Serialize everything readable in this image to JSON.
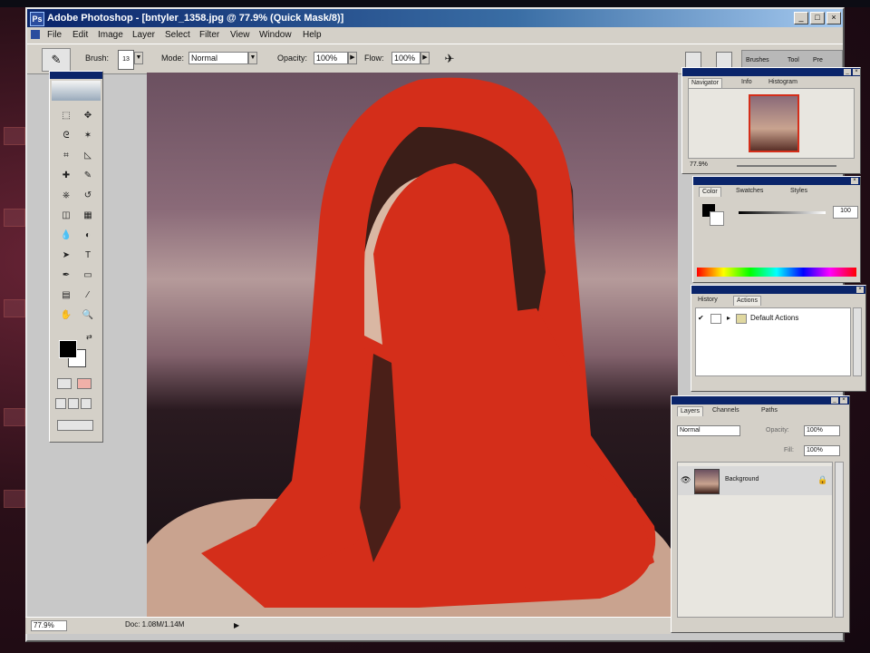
{
  "window": {
    "title": "Adobe Photoshop - [bntyler_1358.jpg @ 77.9% (Quick Mask/8)]",
    "app_icon": "Ps",
    "buttons": [
      "_",
      "□",
      "×"
    ]
  },
  "menu": [
    "File",
    "Edit",
    "Image",
    "Layer",
    "Select",
    "Filter",
    "View",
    "Window",
    "Help"
  ],
  "options_bar": {
    "brush_label": "Brush:",
    "brush_size": "13",
    "mode_label": "Mode:",
    "mode_value": "Normal",
    "opacity_label": "Opacity:",
    "opacity_value": "100%",
    "flow_label": "Flow:",
    "flow_value": "100%",
    "palette_well_tabs": [
      "Brushes",
      "Tool",
      "Pre"
    ]
  },
  "toolbox": {
    "tools": [
      "marquee-icon",
      "move-icon",
      "lasso-icon",
      "magic-wand-icon",
      "crop-icon",
      "slice-icon",
      "healing-icon",
      "brush-icon",
      "stamp-icon",
      "history-brush-icon",
      "eraser-icon",
      "gradient-icon",
      "blur-icon",
      "dodge-icon",
      "path-select-icon",
      "type-icon",
      "pen-icon",
      "shape-icon",
      "notes-icon",
      "eyedropper-icon",
      "hand-icon",
      "zoom-icon"
    ],
    "glyphs": [
      "⬚",
      "✥",
      "ᘓ",
      "✶",
      "⌗",
      "◺",
      "✚",
      "✎",
      "⎈",
      "↺",
      "◫",
      "▦",
      "💧",
      "◐",
      "➤",
      "T",
      "✒",
      "▭",
      "▤",
      "⁄",
      "✋",
      "🔍"
    ]
  },
  "status": {
    "zoom": "77.9%",
    "doc_size": "Doc: 1.08M/1.14M"
  },
  "navigator": {
    "tabs": [
      "Navigator",
      "Info",
      "Histogram"
    ],
    "zoom": "77.9%"
  },
  "color": {
    "tabs": [
      "Color",
      "Swatches",
      "Styles"
    ],
    "value": "100"
  },
  "actions": {
    "tabs": [
      "History",
      "Actions"
    ],
    "items": [
      "Default Actions"
    ]
  },
  "layers": {
    "tabs": [
      "Layers",
      "Channels",
      "Paths"
    ],
    "blend_mode": "Normal",
    "opacity_label": "Opacity:",
    "opacity_value": "100%",
    "fill_label": "Fill:",
    "fill_value": "100%",
    "layer_name": "Background"
  },
  "colors": {
    "title_bar": "#0a246a",
    "quick_mask": "#d42e1a",
    "chrome": "#d4d0c8"
  }
}
